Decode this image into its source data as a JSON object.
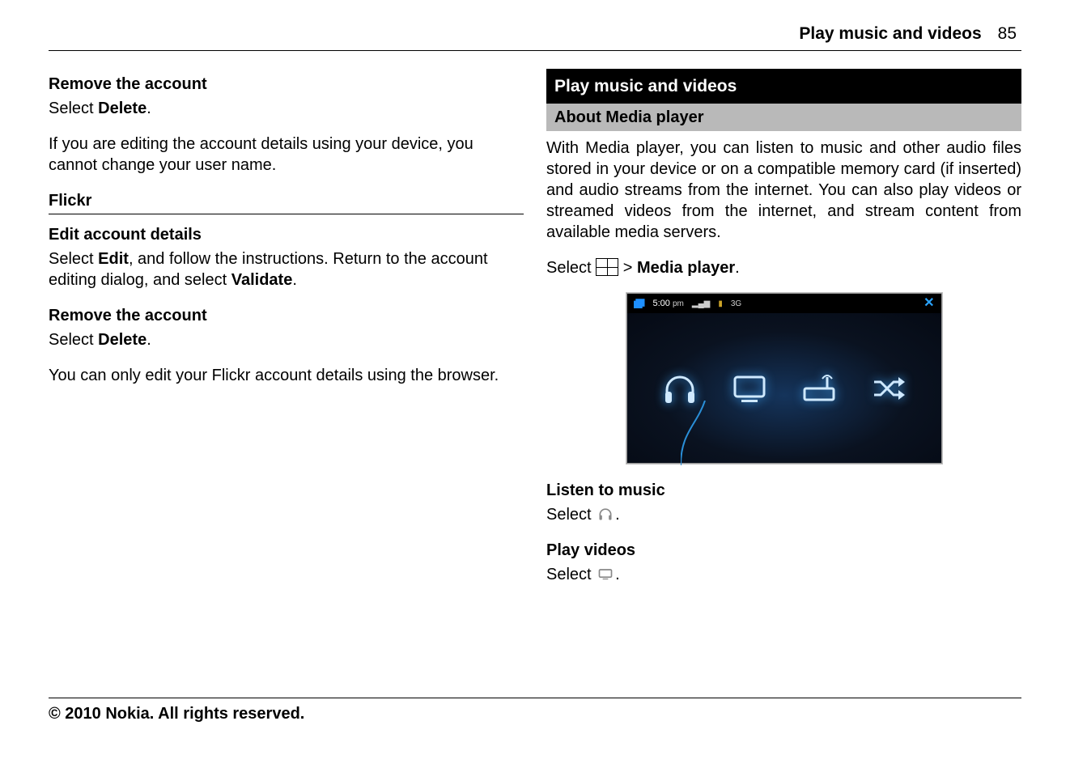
{
  "header": {
    "title": "Play music and videos",
    "page": "85"
  },
  "left": {
    "remove1_h": "Remove the account",
    "remove1_p_a": "Select ",
    "remove1_p_b": "Delete",
    "remove1_p_c": ".",
    "note1": "If you are editing the account details using your device, you cannot change your user name.",
    "flickr_h": "Flickr",
    "edit_h": "Edit account details",
    "edit_p_a": "Select ",
    "edit_p_b": "Edit",
    "edit_p_c": ", and follow the instructions. Return to the account editing dialog, and select ",
    "edit_p_d": "Validate",
    "edit_p_e": ".",
    "remove2_h": "Remove the account",
    "remove2_p_a": "Select ",
    "remove2_p_b": "Delete",
    "remove2_p_c": ".",
    "note2": "You can only edit your Flickr account details using the browser."
  },
  "right": {
    "bar1": "Play music and videos",
    "bar2": "About Media player",
    "about": "With Media player, you can listen to music and other audio files stored in your device or on a compatible memory card (if inserted) and audio streams from the internet. You can also play videos or streamed videos from the internet, and stream content from available media servers.",
    "sel_a": "Select ",
    "sel_b": " > ",
    "sel_c": "Media player",
    "sel_d": ".",
    "mp": {
      "time": "5:00",
      "ampm": "pm",
      "indicators": "3G",
      "close": "✕",
      "icons": [
        "headphones-icon",
        "tv-icon",
        "router-icon",
        "shuffle-icon"
      ]
    },
    "listen_h": "Listen to music",
    "listen_p_a": "Select ",
    "listen_p_b": ".",
    "play_h": "Play videos",
    "play_p_a": "Select ",
    "play_p_b": "."
  },
  "footer": "© 2010 Nokia. All rights reserved."
}
